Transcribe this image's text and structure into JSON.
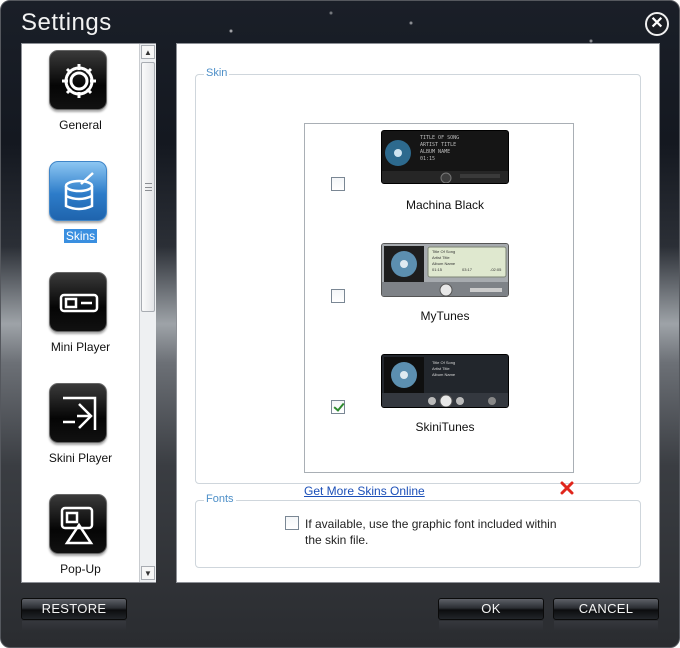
{
  "window": {
    "title": "Settings"
  },
  "sidebar": {
    "items": [
      {
        "label": "General",
        "icon": "gear-icon",
        "selected": false
      },
      {
        "label": "Skins",
        "icon": "paint-bucket-icon",
        "selected": true
      },
      {
        "label": "Mini Player",
        "icon": "mini-player-icon",
        "selected": false
      },
      {
        "label": "Skini Player",
        "icon": "skini-player-icon",
        "selected": false
      },
      {
        "label": "Pop-Up",
        "icon": "pop-up-icon",
        "selected": false
      }
    ]
  },
  "skin_group": {
    "legend": "Skin",
    "skins": [
      {
        "name": "Machina Black",
        "checked": false,
        "preview_lines": [
          "TITLE OF SONG",
          "ARTIST TITLE",
          "ALBUM NAME",
          "01:15"
        ]
      },
      {
        "name": "MyTunes",
        "checked": false,
        "preview_lines": [
          "Title Of Song",
          "Artist Title",
          "Album Name",
          "01:15",
          "03:17",
          "-02:05"
        ]
      },
      {
        "name": "SkiniTunes",
        "checked": true,
        "preview_lines": [
          "Title Of Song",
          "Artist Title",
          "Album Name"
        ]
      }
    ],
    "more_link": "Get More Skins Online"
  },
  "fonts_group": {
    "legend": "Fonts",
    "checkbox_label": "If available, use the graphic font included within the skin file.",
    "checked": false
  },
  "buttons": {
    "restore": "RESTORE",
    "ok": "OK",
    "cancel": "CANCEL"
  },
  "colors": {
    "accent": "#3a8fe0",
    "link": "#1b4fb8",
    "legend": "#4d8fc8",
    "delete": "#e0261c",
    "check": "#2e8a2e"
  }
}
